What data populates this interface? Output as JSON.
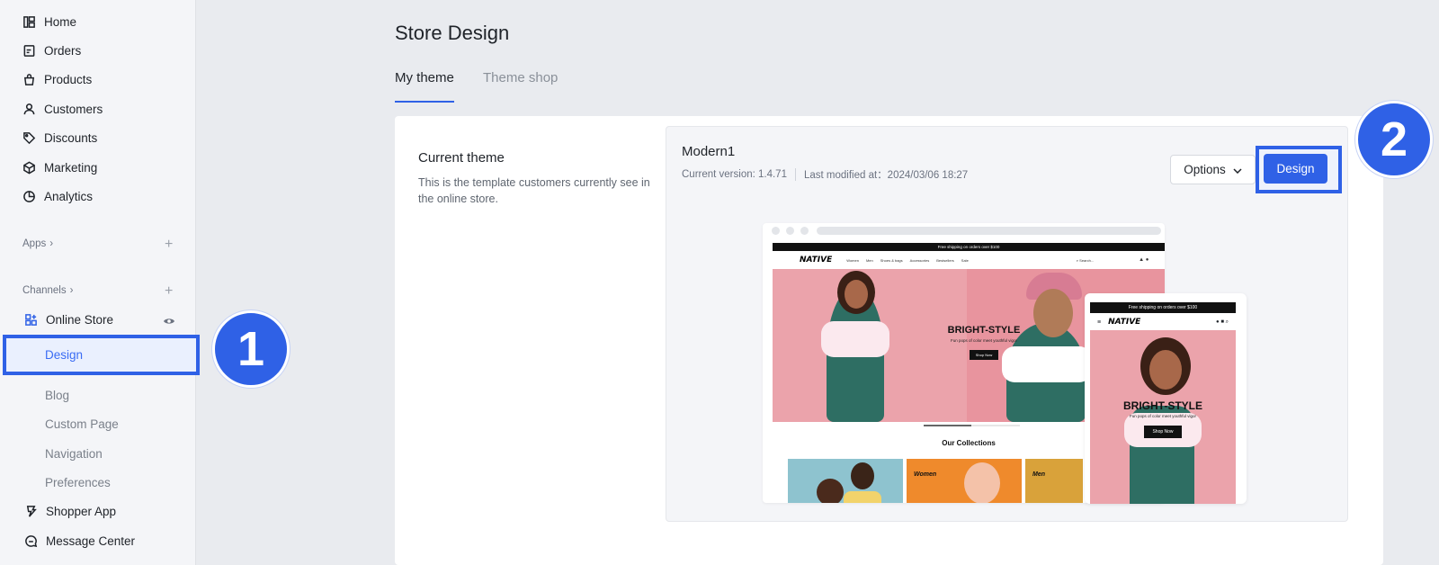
{
  "sidebar": {
    "items": [
      {
        "label": "Home",
        "icon": "home-icon"
      },
      {
        "label": "Orders",
        "icon": "orders-icon"
      },
      {
        "label": "Products",
        "icon": "products-icon"
      },
      {
        "label": "Customers",
        "icon": "customers-icon"
      },
      {
        "label": "Discounts",
        "icon": "discounts-icon"
      },
      {
        "label": "Marketing",
        "icon": "marketing-icon"
      },
      {
        "label": "Analytics",
        "icon": "analytics-icon"
      }
    ],
    "apps_label": "Apps",
    "channels_label": "Channels",
    "online_store": "Online Store",
    "sub_items": [
      "Design",
      "Blog",
      "Custom Page",
      "Navigation",
      "Preferences"
    ],
    "shopper_app": "Shopper App",
    "message_center": "Message Center"
  },
  "annotations": {
    "step1": "1",
    "step2": "2"
  },
  "page": {
    "title": "Store Design",
    "tabs": [
      "My theme",
      "Theme shop"
    ]
  },
  "current_theme": {
    "title": "Current theme",
    "description": "This is the template customers currently see in the online store.",
    "name": "Modern1",
    "version": "Current version: 1.4.71",
    "modified": "Last modified at：2024/03/06 18:27",
    "options_label": "Options",
    "design_label": "Design"
  },
  "preview": {
    "promo": "Free shipping on orders over $100",
    "brand": "NATIVE",
    "nav_links": [
      "Women",
      "Men",
      "Shoes & bags",
      "Accessories",
      "Bestsellers",
      "Sale"
    ],
    "search_placeholder": "Search...",
    "hero_title": "BRIGHT-STYLE",
    "hero_subtitle": "Fun pops of color meet youthful vigor",
    "hero_button": "Shop Now",
    "collections_title": "Our Collections",
    "tiles": [
      "",
      "Women",
      "Men"
    ],
    "mobile_promo": "Free shipping on orders over $100"
  },
  "colors": {
    "accent": "#2f61e6",
    "sidebar_bg": "#f4f5f8",
    "page_bg": "#e9ebef",
    "hero_pink": "#eba3ab"
  }
}
